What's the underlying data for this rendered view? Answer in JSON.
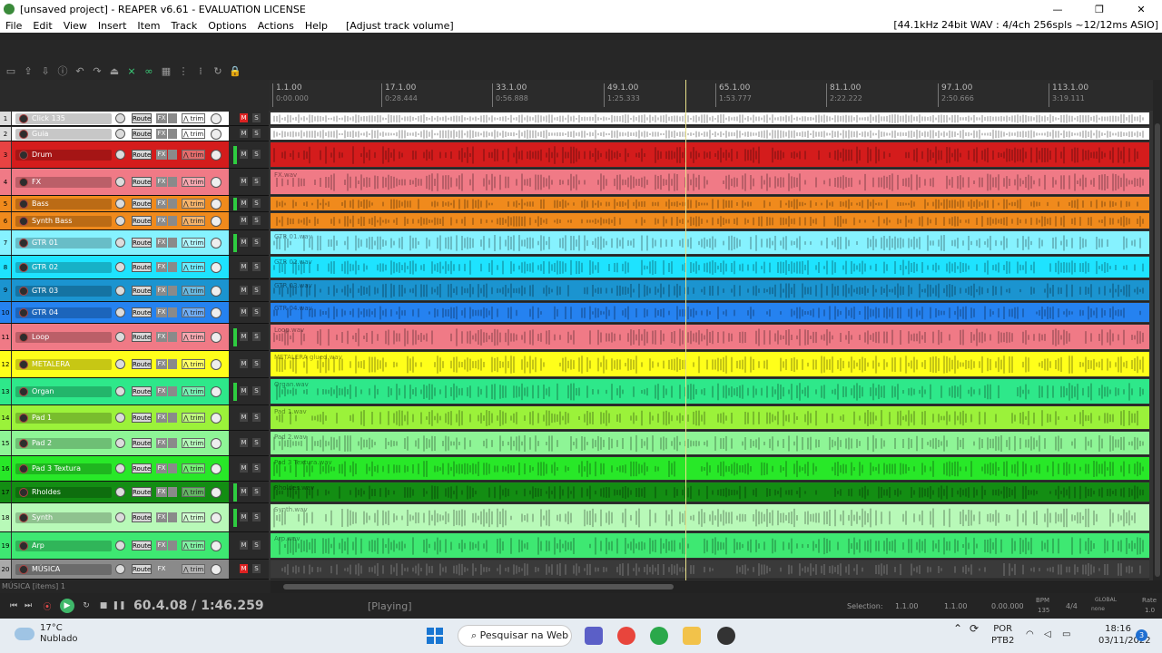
{
  "window": {
    "title": "[unsaved project] - REAPER v6.61 - EVALUATION LICENSE",
    "minimize": "—",
    "maximize": "❐",
    "close": "✕"
  },
  "menu": {
    "items": [
      "File",
      "Edit",
      "View",
      "Insert",
      "Item",
      "Track",
      "Options",
      "Actions",
      "Help"
    ],
    "last_action": "[Adjust track volume]",
    "audio_status": "[44.1kHz 24bit WAV : 4/4ch 256spls ~12/12ms ASIO]"
  },
  "ruler": {
    "marks": [
      {
        "bar": "1.1.00",
        "time": "0:00.000"
      },
      {
        "bar": "17.1.00",
        "time": "0:28.444"
      },
      {
        "bar": "33.1.00",
        "time": "0:56.888"
      },
      {
        "bar": "49.1.00",
        "time": "1:25.333"
      },
      {
        "bar": "65.1.00",
        "time": "1:53.777"
      },
      {
        "bar": "81.1.00",
        "time": "2:22.222"
      },
      {
        "bar": "97.1.00",
        "time": "2:50.666"
      },
      {
        "bar": "113.1.00",
        "time": "3:19.111"
      }
    ]
  },
  "tcp_labels": {
    "route": "Route",
    "fx": "FX",
    "trim": "trim",
    "mute": "M",
    "solo": "S"
  },
  "tracks": [
    {
      "num": "1",
      "name": "Click 135",
      "color": "#ffffff",
      "item": ""
    },
    {
      "num": "2",
      "name": "Guia",
      "color": "#ffffff",
      "item": ""
    },
    {
      "num": "3",
      "name": "Drum",
      "color": "#d41c1c",
      "item": ""
    },
    {
      "num": "4",
      "name": "FX",
      "color": "#f07a86",
      "item": "FX.wav"
    },
    {
      "num": "5",
      "name": "Bass",
      "color": "#f08a1c",
      "item": ""
    },
    {
      "num": "6",
      "name": "Synth Bass",
      "color": "#f08a1c",
      "item": ""
    },
    {
      "num": "7",
      "name": "GTR 01",
      "color": "#86f2ff",
      "item": "GTR 01.wav"
    },
    {
      "num": "8",
      "name": "GTR 02",
      "color": "#1ee3ff",
      "item": "GTR 02.wav"
    },
    {
      "num": "9",
      "name": "GTR 03",
      "color": "#1b94d0",
      "item": "GTR 03.wav"
    },
    {
      "num": "10",
      "name": "GTR 04",
      "color": "#2582f0",
      "item": "GTR 04.wav"
    },
    {
      "num": "11",
      "name": "Loop",
      "color": "#f07a86",
      "item": "Loop.wav"
    },
    {
      "num": "12",
      "name": "METALERA",
      "color": "#ffff1a",
      "item": "METALERA glued.wav"
    },
    {
      "num": "13",
      "name": "Organ",
      "color": "#2ee88a",
      "item": "Organ.wav"
    },
    {
      "num": "14",
      "name": "Pad 1",
      "color": "#9bf23a",
      "item": "Pad 1.wav"
    },
    {
      "num": "15",
      "name": "Pad 2",
      "color": "#8ef596",
      "item": "Pad 2.wav"
    },
    {
      "num": "16",
      "name": "Pad 3 Textura",
      "color": "#28e828",
      "item": "Pad 3 Textura.wav"
    },
    {
      "num": "17",
      "name": "Rholdes",
      "color": "#138d13",
      "item": "Rholdes.wav"
    },
    {
      "num": "18",
      "name": "Synth",
      "color": "#b8f9b8",
      "item": "Synth.wav"
    },
    {
      "num": "19",
      "name": "Arp",
      "color": "#3ee872",
      "item": "Arp.wav"
    },
    {
      "num": "20",
      "name": "MÚSICA",
      "color": "#8a8a8a",
      "item": ""
    }
  ],
  "status": {
    "selected_item": "MÚSICA [items] 1"
  },
  "transport": {
    "position": "60.4.08 / 1:46.259",
    "state": "[Playing]",
    "selection_label": "Selection:",
    "sel_start": "1.1.00",
    "sel_end": "1.1.00",
    "sel_len": "0.00.000",
    "bpm_label": "BPM",
    "bpm": "135",
    "timesig": "4/4",
    "global_label": "GLOBAL",
    "global_mode": "none",
    "rate_label": "Rate",
    "rate": "1.0"
  },
  "taskbar": {
    "temperature": "17°C",
    "weather": "Nublado",
    "search": "Pesquisar na Web",
    "lang1": "POR",
    "lang2": "PTB2",
    "time": "18:16",
    "date": "03/11/2022",
    "notifications": "3"
  }
}
